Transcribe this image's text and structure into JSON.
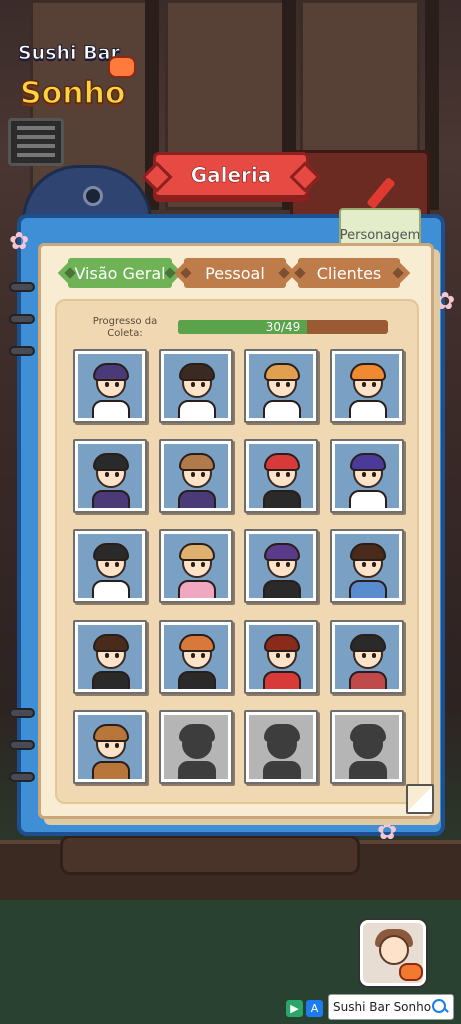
{
  "logo": {
    "line1": "Sushi Bar",
    "line2": "Sonho"
  },
  "title": "Galeria",
  "bookmark_label": "Personagem",
  "tabs": [
    {
      "label": "Visão Geral",
      "active": true
    },
    {
      "label": "Pessoal",
      "active": false
    },
    {
      "label": "Clientes",
      "active": false
    }
  ],
  "progress": {
    "label": "Progresso da Coleta:",
    "current": 30,
    "total": 49,
    "text": "30/49"
  },
  "characters": [
    {
      "name": "character-bandana-chef",
      "hair": "#4a3a78",
      "body": "#ffffff",
      "locked": false
    },
    {
      "name": "character-bun-girl",
      "hair": "#3a2a22",
      "body": "#ffffff",
      "locked": false
    },
    {
      "name": "character-cat-ears",
      "hair": "#e0a050",
      "body": "#ffffff",
      "locked": false
    },
    {
      "name": "character-orange-hair",
      "hair": "#f08a30",
      "body": "#ffffff",
      "locked": false
    },
    {
      "name": "character-headband-man",
      "hair": "#2a2a2a",
      "body": "#4a3a78",
      "locked": false
    },
    {
      "name": "character-ponytail-woman",
      "hair": "#b07a4a",
      "body": "#4a3a78",
      "locked": false
    },
    {
      "name": "character-red-hair-headset",
      "hair": "#d83a3a",
      "body": "#2a2a2a",
      "locked": false
    },
    {
      "name": "character-chef-hat",
      "hair": "#4a3a9a",
      "body": "#ffffff",
      "locked": false
    },
    {
      "name": "character-bearded-chef",
      "hair": "#2a2a2a",
      "body": "#ffffff",
      "locked": false
    },
    {
      "name": "character-pink-bow-girl",
      "hair": "#e0b070",
      "body": "#f0a8c0",
      "locked": false
    },
    {
      "name": "character-maid",
      "hair": "#5a3a8a",
      "body": "#2a2a2a",
      "locked": false
    },
    {
      "name": "character-flower-girl",
      "hair": "#4a2a1a",
      "body": "#5a8ad0",
      "locked": false
    },
    {
      "name": "character-dark-hair-man",
      "hair": "#4a2a1a",
      "body": "#2a2a2a",
      "locked": false
    },
    {
      "name": "character-orange-bun-girl",
      "hair": "#d8783a",
      "body": "#2a2a2a",
      "locked": false
    },
    {
      "name": "character-kabuki",
      "hair": "#8a2a1a",
      "body": "#d83a3a",
      "locked": false
    },
    {
      "name": "character-geisha",
      "hair": "#2a2a2a",
      "body": "#c04a4a",
      "locked": false
    },
    {
      "name": "character-tanuki",
      "hair": "#b8763a",
      "body": "#b8763a",
      "locked": false
    },
    {
      "name": "character-locked-1",
      "hair": "#3d3d3d",
      "body": "#3d3d3d",
      "locked": true
    },
    {
      "name": "character-locked-2",
      "hair": "#3d3d3d",
      "body": "#3d3d3d",
      "locked": true
    },
    {
      "name": "character-locked-3",
      "hair": "#3d3d3d",
      "body": "#3d3d3d",
      "locked": true
    }
  ],
  "ad": {
    "app_name": "Sushi Bar Sonho"
  },
  "colors": {
    "book_blue": "#3f8fd6",
    "banner_red": "#e64a43",
    "tab_active": "#6fb356",
    "tab_inactive": "#bf7c4b",
    "progress_fill": "#5aa34a",
    "progress_track": "#9a5a34"
  },
  "icons": {
    "store_play": "play-store-icon",
    "store_apple": "app-store-icon",
    "search": "search-icon"
  }
}
